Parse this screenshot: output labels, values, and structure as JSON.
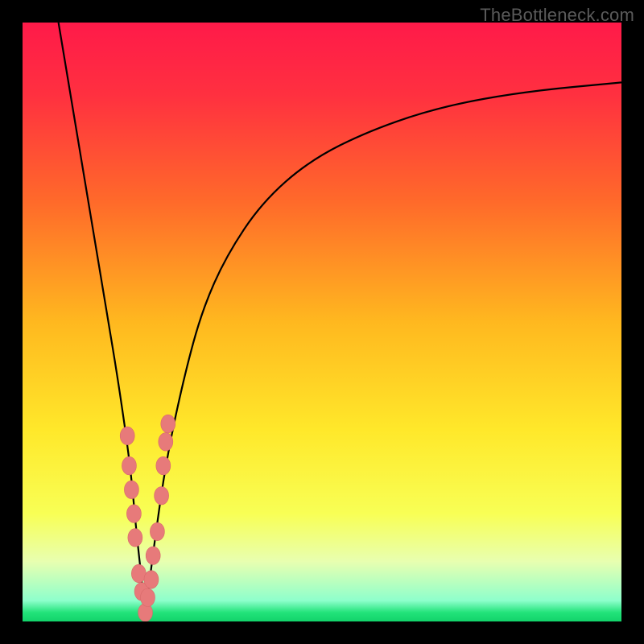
{
  "attribution": "TheBottleneck.com",
  "colors": {
    "frame": "#000000",
    "gradient_stops": [
      {
        "offset": 0.0,
        "color": "#ff1a49"
      },
      {
        "offset": 0.12,
        "color": "#ff3040"
      },
      {
        "offset": 0.3,
        "color": "#ff6a2a"
      },
      {
        "offset": 0.5,
        "color": "#ffb81f"
      },
      {
        "offset": 0.68,
        "color": "#ffe82a"
      },
      {
        "offset": 0.82,
        "color": "#f8ff55"
      },
      {
        "offset": 0.9,
        "color": "#e8ffb0"
      },
      {
        "offset": 0.965,
        "color": "#8effcc"
      },
      {
        "offset": 0.985,
        "color": "#22e37a"
      },
      {
        "offset": 1.0,
        "color": "#12d36a"
      }
    ],
    "curve": "#000000",
    "marker_fill": "#e77a7a",
    "marker_stroke": "#d86a6a"
  },
  "chart_data": {
    "type": "line",
    "title": "",
    "xlabel": "",
    "ylabel": "",
    "xlim": [
      0,
      100
    ],
    "ylim": [
      0,
      100
    ],
    "grid": false,
    "legend": false,
    "series": [
      {
        "name": "bottleneck-curve",
        "x": [
          6,
          8,
          10,
          12,
          14,
          16,
          18,
          19,
          20,
          20.5,
          21,
          22,
          24,
          27,
          30,
          34,
          40,
          48,
          58,
          70,
          84,
          100
        ],
        "y": [
          100,
          88,
          76,
          64,
          52,
          40,
          26,
          15,
          6,
          0,
          5,
          13,
          27,
          41,
          52,
          61,
          70,
          77,
          82,
          86,
          88.5,
          90
        ]
      }
    ],
    "markers": [
      {
        "x": 17.5,
        "y": 31
      },
      {
        "x": 17.8,
        "y": 26
      },
      {
        "x": 18.2,
        "y": 22
      },
      {
        "x": 18.6,
        "y": 18
      },
      {
        "x": 18.8,
        "y": 14
      },
      {
        "x": 19.4,
        "y": 8
      },
      {
        "x": 19.9,
        "y": 5
      },
      {
        "x": 20.5,
        "y": 1.5
      },
      {
        "x": 20.9,
        "y": 4
      },
      {
        "x": 21.5,
        "y": 7
      },
      {
        "x": 21.8,
        "y": 11
      },
      {
        "x": 22.5,
        "y": 15
      },
      {
        "x": 23.2,
        "y": 21
      },
      {
        "x": 23.5,
        "y": 26
      },
      {
        "x": 23.9,
        "y": 30
      },
      {
        "x": 24.3,
        "y": 33
      }
    ],
    "marker_radius_px": 9
  }
}
